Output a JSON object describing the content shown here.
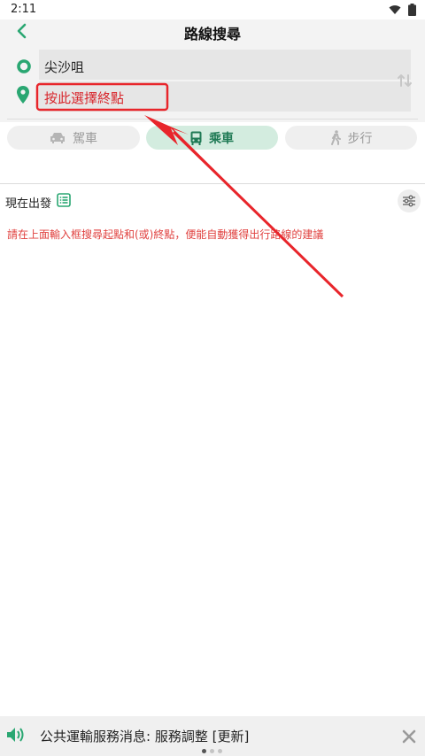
{
  "status_bar": {
    "time": "2:11"
  },
  "header": {
    "title": "路線搜尋"
  },
  "route": {
    "origin": "尖沙咀",
    "destination_placeholder": "按此選擇終點"
  },
  "modes": [
    {
      "label": "駕車",
      "icon": "car-icon",
      "active": false
    },
    {
      "label": "乘車",
      "icon": "bus-icon",
      "active": true
    },
    {
      "label": "步行",
      "icon": "walk-icon",
      "active": false
    }
  ],
  "departure": {
    "label": "現在出發"
  },
  "hint": "請在上面輸入框搜尋起點和(或)終點，便能自動獲得出行路線的建議",
  "news": {
    "text": "公共運輸服務消息: 服務調整 [更新]",
    "page_count": 3,
    "current_page": 1
  },
  "colors": {
    "brand_green": "#2aa772",
    "hint_red": "#e0413f",
    "annotation_red": "#e8252b"
  }
}
